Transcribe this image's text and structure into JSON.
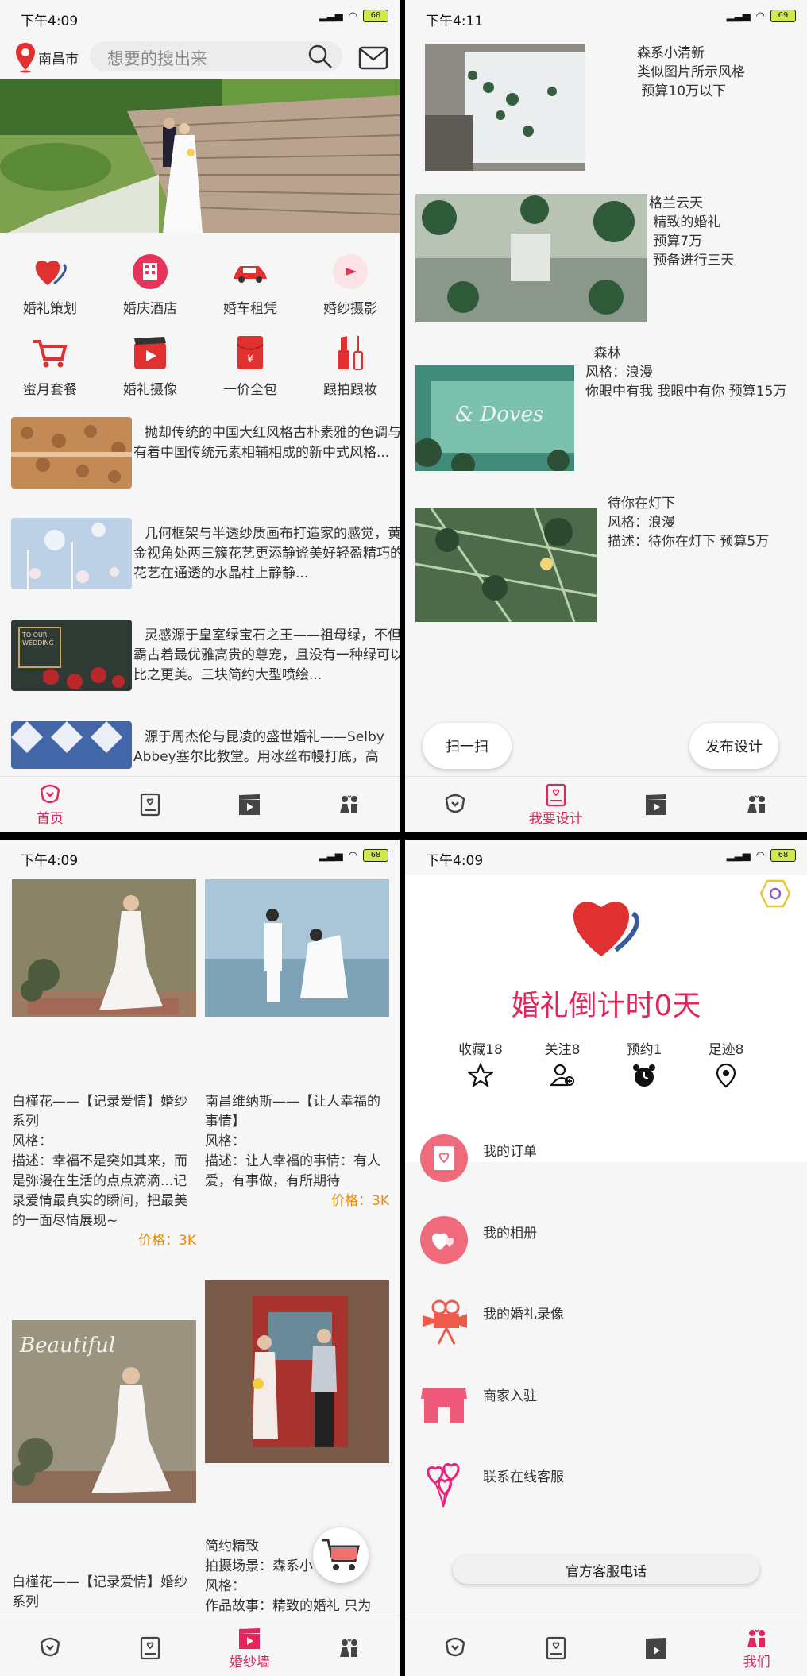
{
  "status": {
    "p1_time": "下午4:09",
    "p2_time": "下午4:11",
    "p3_time": "下午4:09",
    "p4_time": "下午4:09",
    "battery_p1": "68",
    "battery_p2": "69",
    "battery_p3": "68",
    "battery_p4": "68"
  },
  "tabs": {
    "home": "首页",
    "design": "我要设计",
    "gallery": "婚纱墙",
    "mine": "我们"
  },
  "home": {
    "city": "南昌市",
    "search_placeholder": "想要的搜出来",
    "services": [
      {
        "label": "婚礼策划",
        "icon": "heart-icon"
      },
      {
        "label": "婚庆酒店",
        "icon": "hotel-icon"
      },
      {
        "label": "婚车租凭",
        "icon": "car-icon"
      },
      {
        "label": "婚纱摄影",
        "icon": "camera-icon"
      },
      {
        "label": "蜜月套餐",
        "icon": "cart-icon"
      },
      {
        "label": "婚礼摄像",
        "icon": "video-icon"
      },
      {
        "label": "一价全包",
        "icon": "red-envelope-icon"
      },
      {
        "label": "跟拍跟妆",
        "icon": "lipstick-icon"
      }
    ],
    "articles": [
      {
        "text": "抛却传统的中国大红风格古朴素雅的色调与有着中国传统元素相辅相成的新中式风格..."
      },
      {
        "text": "几何框架与半透纱质画布打造家的感觉，黄金视角处两三簇花艺更添静谧美好轻盈精巧的花艺在通透的水晶柱上静静..."
      },
      {
        "text": "灵感源于皇室绿宝石之王——祖母绿，不但霸占着最优雅高贵的尊宠，且没有一种绿可以比之更美。三块简约大型喷绘..."
      },
      {
        "text": "源于周杰伦与昆凌的盛世婚礼——Selby Abbey塞尔比教堂。用冰丝布幔打底，高"
      }
    ]
  },
  "design": {
    "items": [
      {
        "lines": [
          "森系小清新",
          "类似图片所示风格",
          " 预算10万以下"
        ]
      },
      {
        "lines": [
          "格兰云天",
          " 精致的婚礼",
          " 预算7万",
          " 预备进行三天"
        ]
      },
      {
        "lines": [
          "  森林",
          "风格：浪漫",
          " 你眼中有我 我眼中有你 预算15万"
        ]
      },
      {
        "lines": [
          "待你在灯下",
          "风格：浪漫",
          "描述：待你在灯下  预算5万"
        ]
      }
    ],
    "scan_button": "扫一扫",
    "publish_button": "发布设计"
  },
  "gallery": {
    "cards": [
      {
        "title": "白槿花——【记录爱情】婚纱系列",
        "style": "风格：",
        "desc": "描述：幸福不是突如其来，而是弥漫在生活的点点滴滴...记录爱情最真实的瞬间，把最美的一面尽情展现~",
        "price": "价格：3K"
      },
      {
        "title": "南昌维纳斯——【让人幸福的事情】",
        "style": "风格：",
        "desc": "描述：让人幸福的事情：有人爱，有事做，有所期待",
        "price": "价格：3K"
      },
      {
        "title": "白槿花——【记录爱情】婚纱系列",
        "style": "",
        "desc": "",
        "price": ""
      },
      {
        "title": "简约精致",
        "style": "拍摄场景：森系小",
        "desc": "风格：",
        "price": "作品故事：精致的婚礼 只为"
      }
    ],
    "photo3_overlay": "Beautiful"
  },
  "mine": {
    "countdown": "婚礼倒计时0天",
    "stats": [
      {
        "label": "收藏18",
        "icon": "star-icon"
      },
      {
        "label": "关注8",
        "icon": "follow-user-icon"
      },
      {
        "label": "预约1",
        "icon": "alarm-icon"
      },
      {
        "label": "足迹8",
        "icon": "location-pin-icon"
      }
    ],
    "menu": [
      {
        "label": "我的订单",
        "icon": "order-icon"
      },
      {
        "label": "我的相册",
        "icon": "album-icon"
      },
      {
        "label": "我的婚礼录像",
        "icon": "movie-camera-icon"
      },
      {
        "label": "商家入驻",
        "icon": "shop-icon"
      },
      {
        "label": "联系在线客服",
        "icon": "balloons-icon"
      }
    ],
    "hotline_button": "官方客服电话"
  },
  "colors": {
    "accent": "#e5245a",
    "price": "#ef8a00",
    "background": "#f6f6f6"
  }
}
